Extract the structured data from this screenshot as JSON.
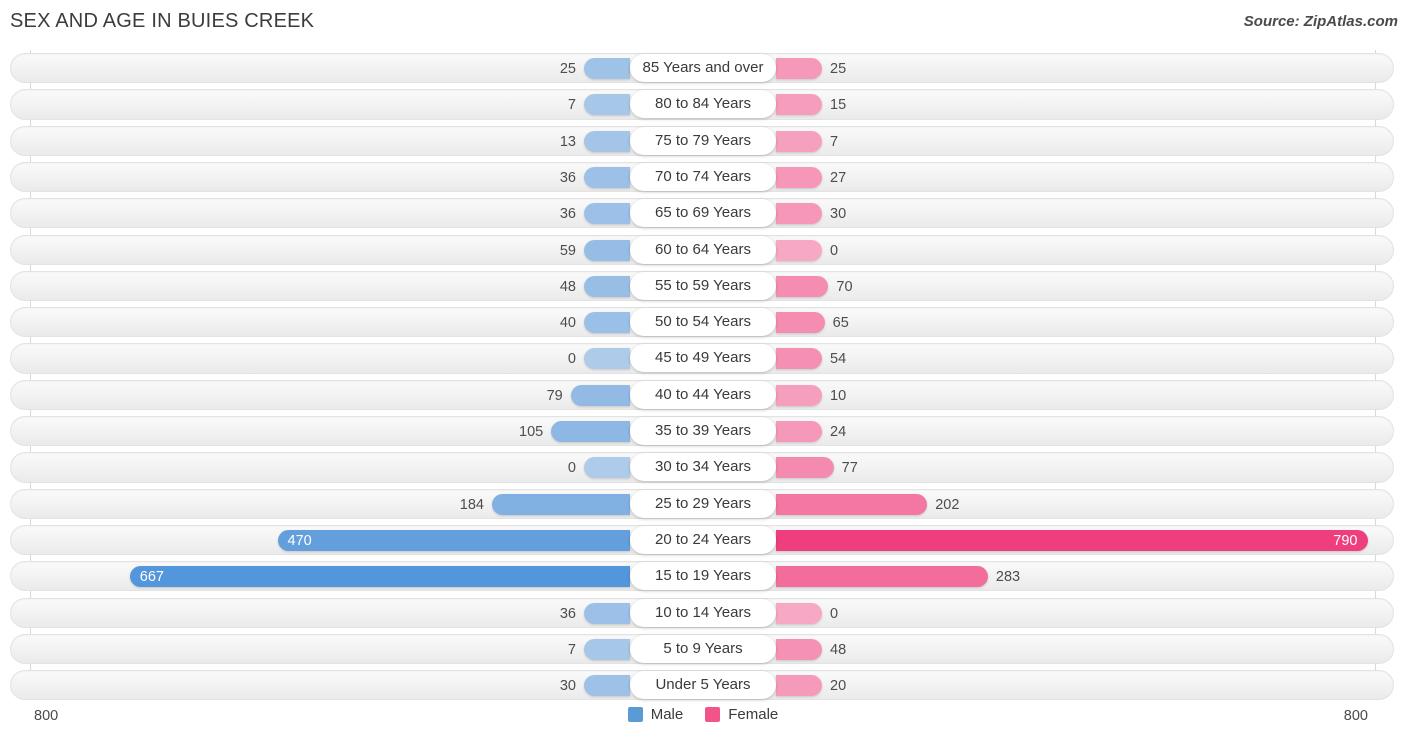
{
  "header": {
    "title": "SEX AND AGE IN BUIES CREEK",
    "source": "Source: ZipAtlas.com"
  },
  "legend": {
    "male_label": "Male",
    "female_label": "Female",
    "male_color": "#5b9bd5",
    "female_color": "#f2548a"
  },
  "axis": {
    "left_max_label": "800",
    "right_max_label": "800",
    "max_value": 800
  },
  "chart_data": {
    "type": "bar",
    "title": "SEX AND AGE IN BUIES CREEK",
    "subtitle": "Source: ZipAtlas.com",
    "orientation": "horizontal",
    "style": "population-pyramid",
    "xlabel": "",
    "ylabel": "",
    "grid": true,
    "legend_position": "bottom",
    "xlim": [
      -800,
      800
    ],
    "axis_max": 800,
    "categories": [
      "85 Years and over",
      "80 to 84 Years",
      "75 to 79 Years",
      "70 to 74 Years",
      "65 to 69 Years",
      "60 to 64 Years",
      "55 to 59 Years",
      "50 to 54 Years",
      "45 to 49 Years",
      "40 to 44 Years",
      "35 to 39 Years",
      "30 to 34 Years",
      "25 to 29 Years",
      "20 to 24 Years",
      "15 to 19 Years",
      "10 to 14 Years",
      "5 to 9 Years",
      "Under 5 Years"
    ],
    "series": [
      {
        "name": "Male",
        "color": "#5b9bd5",
        "values": [
          25,
          7,
          13,
          36,
          36,
          59,
          48,
          40,
          0,
          79,
          105,
          0,
          184,
          470,
          667,
          36,
          7,
          30
        ]
      },
      {
        "name": "Female",
        "color": "#f2548a",
        "values": [
          25,
          15,
          7,
          27,
          30,
          0,
          70,
          65,
          54,
          10,
          24,
          77,
          202,
          790,
          283,
          0,
          48,
          20
        ]
      }
    ]
  },
  "rows": [
    {
      "label": "85 Years and over",
      "male": 25,
      "female": 25,
      "male_text": "25",
      "female_text": "25"
    },
    {
      "label": "80 to 84 Years",
      "male": 7,
      "female": 15,
      "male_text": "7",
      "female_text": "15"
    },
    {
      "label": "75 to 79 Years",
      "male": 13,
      "female": 7,
      "male_text": "13",
      "female_text": "7"
    },
    {
      "label": "70 to 74 Years",
      "male": 36,
      "female": 27,
      "male_text": "36",
      "female_text": "27"
    },
    {
      "label": "65 to 69 Years",
      "male": 36,
      "female": 30,
      "male_text": "36",
      "female_text": "30"
    },
    {
      "label": "60 to 64 Years",
      "male": 59,
      "female": 0,
      "male_text": "59",
      "female_text": "0"
    },
    {
      "label": "55 to 59 Years",
      "male": 48,
      "female": 70,
      "male_text": "48",
      "female_text": "70"
    },
    {
      "label": "50 to 54 Years",
      "male": 40,
      "female": 65,
      "male_text": "40",
      "female_text": "65"
    },
    {
      "label": "45 to 49 Years",
      "male": 0,
      "female": 54,
      "male_text": "0",
      "female_text": "54"
    },
    {
      "label": "40 to 44 Years",
      "male": 79,
      "female": 10,
      "male_text": "79",
      "female_text": "10"
    },
    {
      "label": "35 to 39 Years",
      "male": 105,
      "female": 24,
      "male_text": "105",
      "female_text": "24"
    },
    {
      "label": "30 to 34 Years",
      "male": 0,
      "female": 77,
      "male_text": "0",
      "female_text": "77"
    },
    {
      "label": "25 to 29 Years",
      "male": 184,
      "female": 202,
      "male_text": "184",
      "female_text": "202"
    },
    {
      "label": "20 to 24 Years",
      "male": 470,
      "female": 790,
      "male_text": "470",
      "female_text": "790"
    },
    {
      "label": "15 to 19 Years",
      "male": 667,
      "female": 283,
      "male_text": "667",
      "female_text": "283"
    },
    {
      "label": "10 to 14 Years",
      "male": 36,
      "female": 0,
      "male_text": "36",
      "female_text": "0"
    },
    {
      "label": "5 to 9 Years",
      "male": 7,
      "female": 48,
      "male_text": "7",
      "female_text": "48"
    },
    {
      "label": "Under 5 Years",
      "male": 30,
      "female": 20,
      "male_text": "30",
      "female_text": "20"
    }
  ]
}
